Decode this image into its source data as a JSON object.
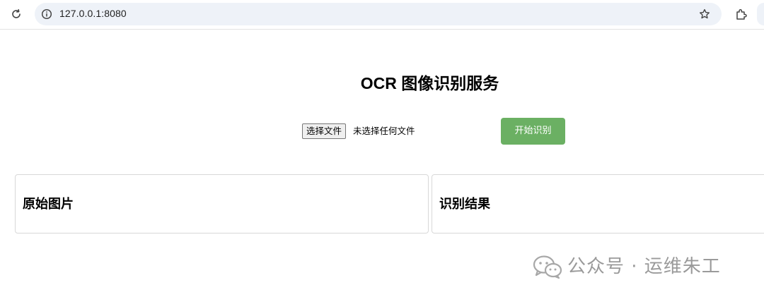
{
  "browser": {
    "url": "127.0.0.1:8080",
    "icons": [
      "reload-icon",
      "info-icon",
      "star-icon",
      "extensions-icon"
    ]
  },
  "page": {
    "title": "OCR 图像识别服务",
    "file_input": {
      "button_label": "选择文件",
      "status_text": "未选择任何文件"
    },
    "start_button": {
      "label": "开始识别",
      "color": "#6bb063"
    },
    "panels": [
      {
        "title": "原始图片"
      },
      {
        "title": "识别结果"
      }
    ]
  },
  "watermark": {
    "text": "公众号 · 运维朱工",
    "icon": "wechat-logo-icon"
  }
}
